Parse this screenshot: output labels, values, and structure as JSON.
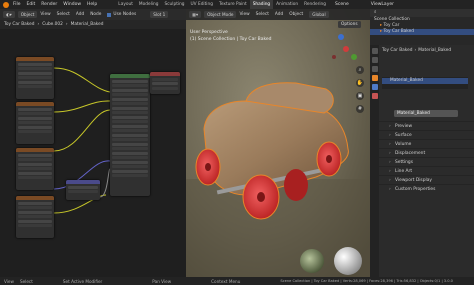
{
  "menubar": {
    "menus": [
      "File",
      "Edit",
      "Render",
      "Window",
      "Help"
    ],
    "workspaces": [
      "Layout",
      "Modeling",
      "Sculpting",
      "UV Editing",
      "Texture Paint",
      "Shading",
      "Animation",
      "Rendering"
    ],
    "active_workspace": "Shading",
    "scene": "Scene",
    "view_layer": "ViewLayer"
  },
  "node_editor": {
    "mode": "Object",
    "menus": [
      "View",
      "Select",
      "Add",
      "Node"
    ],
    "use_nodes": "Use Nodes",
    "slot": "Slot 1",
    "breadcrumb": [
      "Toy Car Baked",
      "Cube.002",
      "Material_Baked"
    ]
  },
  "viewport": {
    "mode": "Object Mode",
    "menus": [
      "View",
      "Select",
      "Add",
      "Object"
    ],
    "orientation": "Global",
    "perspective": "User Perspective",
    "collection": "(1) Scene Collection | Toy Car Baked",
    "options": "Options"
  },
  "outliner": {
    "title": "Scene Collection",
    "items": [
      "Toy Car",
      "Toy Car Baked"
    ]
  },
  "properties": {
    "breadcrumb": [
      "Toy Car Baked",
      "Material_Baked"
    ],
    "material_slot": "Material_Baked",
    "material_name": "Material_Baked",
    "sections": [
      "Preview",
      "Surface",
      "Volume",
      "Displacement",
      "Settings",
      "Line Art",
      "Viewport Display",
      "Custom Properties"
    ]
  },
  "statusbar": {
    "left": [
      "View",
      "Select"
    ],
    "items": [
      "Set Active Modifier",
      "Pan View",
      "Context Menu"
    ],
    "stats": "Scene Collection | Toy Car Baked | Verts:28,069 | Faces:28,396 | Tris:56,832 | Objects:0/1 | 3.0.0"
  },
  "colors": {
    "accent": "#e87d0d",
    "active_tab": "#3b3b3b",
    "selection": "#4772b3"
  }
}
